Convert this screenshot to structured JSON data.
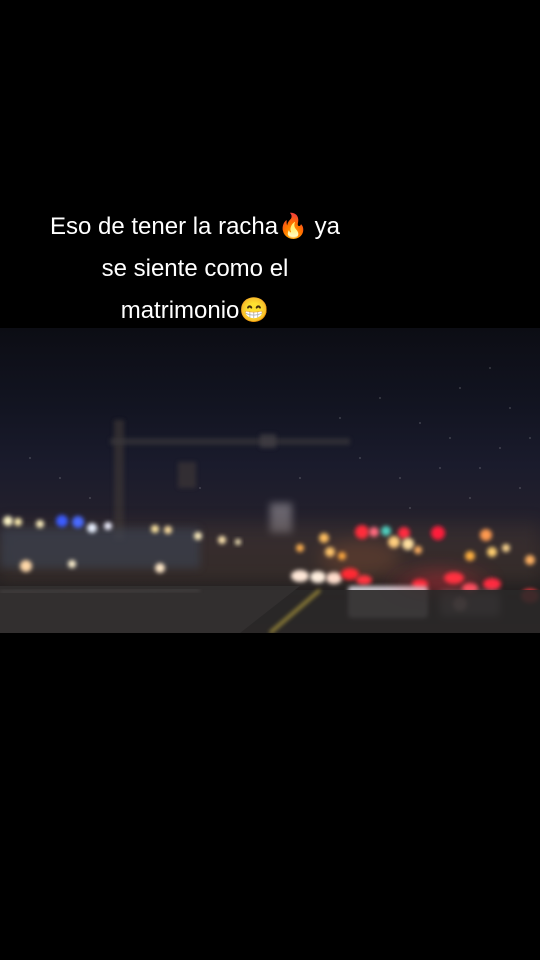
{
  "caption": {
    "line1": "Eso de tener la racha🔥 ya",
    "line2": "se siente como el",
    "line3": "matrimonio😁"
  },
  "photo": {
    "subject": "night-street-bokeh"
  },
  "colors": {
    "background": "#000000",
    "caption_text": "#ffffff"
  }
}
